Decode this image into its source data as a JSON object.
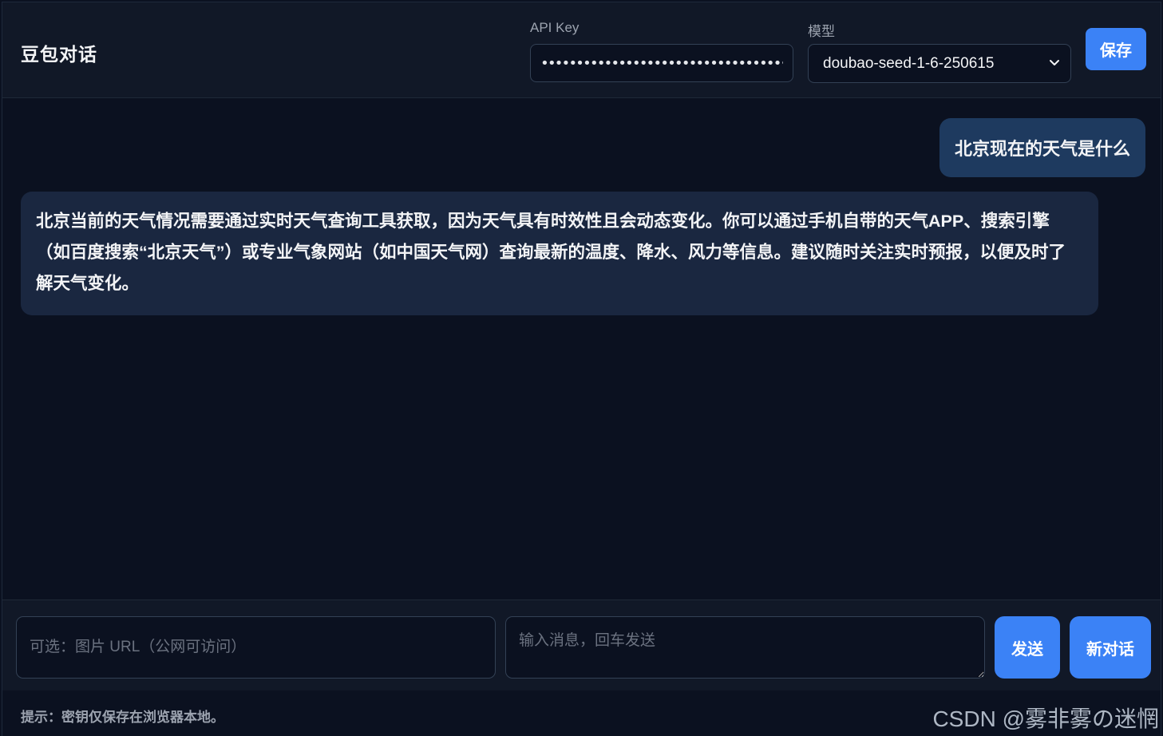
{
  "header": {
    "title": "豆包对话",
    "api_key_label": "API Key",
    "api_key_value": "••••••••••••••••••••••••••••••••••••••",
    "model_label": "模型",
    "model_selected": "doubao-seed-1-6-250615",
    "save_label": "保存"
  },
  "messages": [
    {
      "role": "user",
      "text": "北京现在的天气是什么"
    },
    {
      "role": "assistant",
      "text": "北京当前的天气情况需要通过实时天气查询工具获取，因为天气具有时效性且会动态变化。你可以通过手机自带的天气APP、搜索引擎（如百度搜索“北京天气”）或专业气象网站（如中国天气网）查询最新的温度、降水、风力等信息。建议随时关注实时预报，以便及时了解天气变化。"
    }
  ],
  "composer": {
    "image_url_placeholder": "可选：图片 URL（公网可访问）",
    "message_placeholder": "输入消息，回车发送",
    "send_label": "发送",
    "new_chat_label": "新对话"
  },
  "footer": {
    "hint": "提示：密钥仅保存在浏览器本地。",
    "watermark": "CSDN @雾非雾の迷惘"
  },
  "colors": {
    "accent": "#3b82f6",
    "background": "#0b1120",
    "header_bg": "#111827",
    "user_bubble": "#1e3a5f",
    "assistant_bubble": "#1a2740"
  }
}
